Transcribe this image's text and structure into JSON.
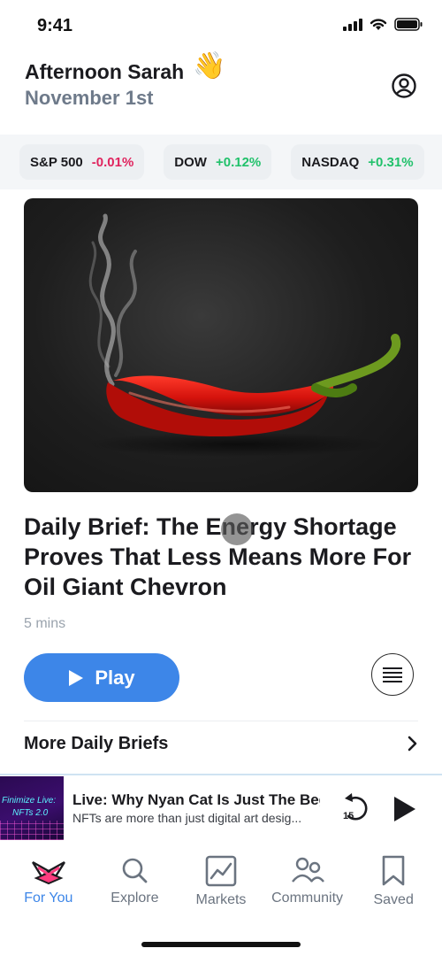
{
  "status_bar": {
    "time": "9:41"
  },
  "header": {
    "greeting": "Afternoon Sarah",
    "wave_emoji": "👋",
    "date": "November 1st"
  },
  "tickers": [
    {
      "name": "S&P 500",
      "change": "-0.01%",
      "direction": "down"
    },
    {
      "name": "DOW",
      "change": "+0.12%",
      "direction": "up"
    },
    {
      "name": "NASDAQ",
      "change": "+0.31%",
      "direction": "up"
    }
  ],
  "article": {
    "hero_image": "red-chili-pepper-smoke",
    "title": "Daily Brief: The Energy Shortage Proves That Less Means More For Oil Giant Chevron",
    "read_time": "5 mins",
    "play_label": "Play"
  },
  "more_briefs_label": "More Daily Briefs",
  "mini_player": {
    "thumbnail_line1": "Finimize Live:",
    "thumbnail_line2": "NFTs 2.0",
    "title": "Live: Why Nyan Cat Is Just The Beg",
    "subtitle": "NFTs are more than just digital art desig...",
    "rewind_seconds": "15"
  },
  "tabs": [
    {
      "label": "For You",
      "icon": "for-you-icon",
      "active": true
    },
    {
      "label": "Explore",
      "icon": "search-icon",
      "active": false
    },
    {
      "label": "Markets",
      "icon": "chart-icon",
      "active": false
    },
    {
      "label": "Community",
      "icon": "people-icon",
      "active": false
    },
    {
      "label": "Saved",
      "icon": "bookmark-icon",
      "active": false
    }
  ],
  "colors": {
    "accent": "#3d86e8",
    "negative": "#e0245e",
    "positive": "#21c16b"
  }
}
